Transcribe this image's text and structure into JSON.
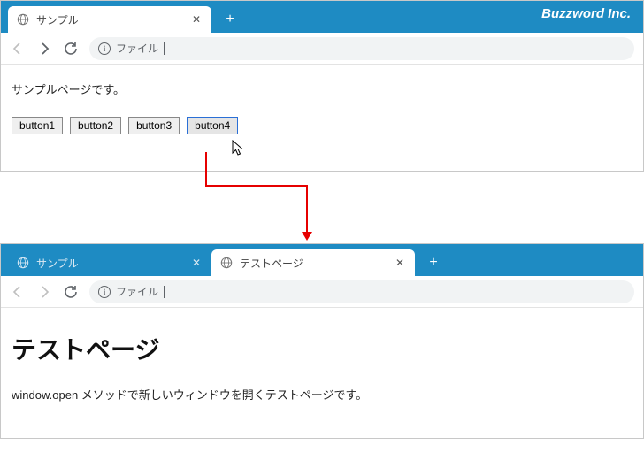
{
  "brand": "Buzzword Inc.",
  "windows": {
    "top": {
      "tabs": [
        {
          "title": "サンプル",
          "active": true
        }
      ],
      "address_label": "ファイル",
      "page": {
        "intro": "サンプルページです。",
        "buttons": [
          "button1",
          "button2",
          "button3",
          "button4"
        ],
        "selected_index": 3
      }
    },
    "bottom": {
      "tabs": [
        {
          "title": "サンプル",
          "active": false
        },
        {
          "title": "テストページ",
          "active": true
        }
      ],
      "address_label": "ファイル",
      "page": {
        "heading": "テストページ",
        "body": "window.open メソッドで新しいウィンドウを開くテストページです。"
      }
    }
  }
}
